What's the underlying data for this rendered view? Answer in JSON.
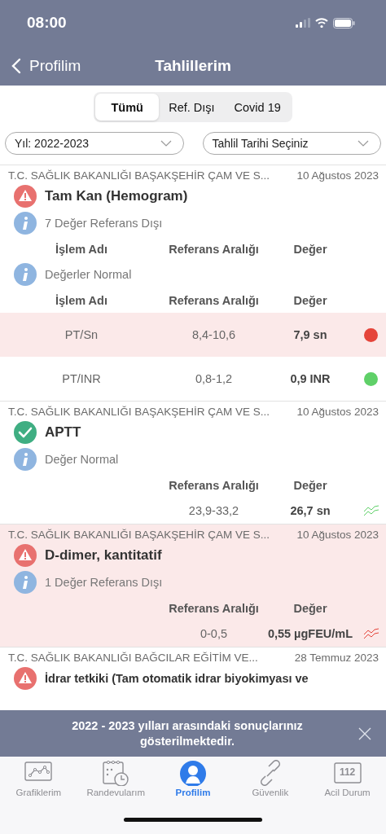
{
  "status_bar": {
    "time": "08:00"
  },
  "nav": {
    "back": "Profilim",
    "title": "Tahlillerim"
  },
  "segments": [
    {
      "label": "Tümü",
      "selected": true
    },
    {
      "label": "Ref. Dışı",
      "selected": false
    },
    {
      "label": "Covid 19",
      "selected": false
    }
  ],
  "filters": [
    {
      "value": "Yıl: 2022-2023"
    },
    {
      "value": "Tahlil Tarihi Seçiniz"
    }
  ],
  "results": [
    {
      "hospital": "T.C. SAĞLIK BAKANLIĞI BAŞAKŞEHİR ÇAM VE S...",
      "date": "10 Ağustos 2023",
      "kind": "warning",
      "highlighted": false,
      "title": "Tam Kan (Hemogram)",
      "sections": [
        {
          "info": "7 Değer Referans Dışı",
          "columns": {
            "name": "İşlem Adı",
            "range": "Referans Aralığı",
            "value": "Değer"
          }
        },
        {
          "info": "Değerler Normal",
          "columns": {
            "name": "İşlem Adı",
            "range": "Referans Aralığı",
            "value": "Değer"
          },
          "rows": [
            {
              "name": "PT/Sn",
              "range": "8,4-10,6",
              "value": "7,9 sn",
              "highlighted": true,
              "kind": "dot",
              "color": "#e5443a"
            },
            {
              "name": "PT/INR",
              "range": "0,8-1,2",
              "value": "0,9 INR",
              "highlighted": false,
              "kind": "dot",
              "color": "#5fd068"
            }
          ]
        }
      ]
    },
    {
      "hospital": "T.C. SAĞLIK BAKANLIĞI BAŞAKŞEHİR ÇAM VE S...",
      "date": "10 Ağustos 2023",
      "kind": "ok",
      "highlighted": false,
      "title": "APTT",
      "sections": [
        {
          "info": "Değer Normal",
          "columns": {
            "range": "Referans Aralığı",
            "value": "Değer"
          },
          "rows": [
            {
              "range": "23,9-33,2",
              "value": "26,7 sn",
              "kind": "trend",
              "color": "#5fd068"
            }
          ]
        }
      ]
    },
    {
      "hospital": "T.C. SAĞLIK BAKANLIĞI BAŞAKŞEHİR ÇAM VE S...",
      "date": "10 Ağustos 2023",
      "kind": "warning",
      "highlighted": true,
      "title": "D-dimer, kantitatif",
      "sections": [
        {
          "info": "1 Değer Referans Dışı",
          "columns": {
            "range": "Referans Aralığı",
            "value": "Değer"
          },
          "rows": [
            {
              "range": "0-0,5",
              "value": "0,55 µgFEU/mL",
              "kind": "trend",
              "color": "#e5443a"
            }
          ]
        }
      ]
    },
    {
      "hospital": "T.C. SAĞLIK BAKANLIĞI BAĞCILAR EĞİTİM VE...",
      "date": "28 Temmuz 2023",
      "kind": "warning",
      "highlighted": false,
      "title": "İdrar tetkiki (Tam otomatik idrar biyokimyası ve"
    }
  ],
  "banner": {
    "text": "2022 - 2023 yılları arasındaki sonuçlarınız gösterilmektedir."
  },
  "tabs": [
    {
      "label": "Grafiklerim",
      "kind": "chart",
      "selected": false
    },
    {
      "label": "Randevularım",
      "kind": "calendar",
      "selected": false
    },
    {
      "label": "Profilim",
      "kind": "profile",
      "selected": true
    },
    {
      "label": "Güvenlik",
      "kind": "link",
      "selected": false
    },
    {
      "label": "Acil Durum",
      "kind": "emergency",
      "badge": "112",
      "selected": false
    }
  ]
}
